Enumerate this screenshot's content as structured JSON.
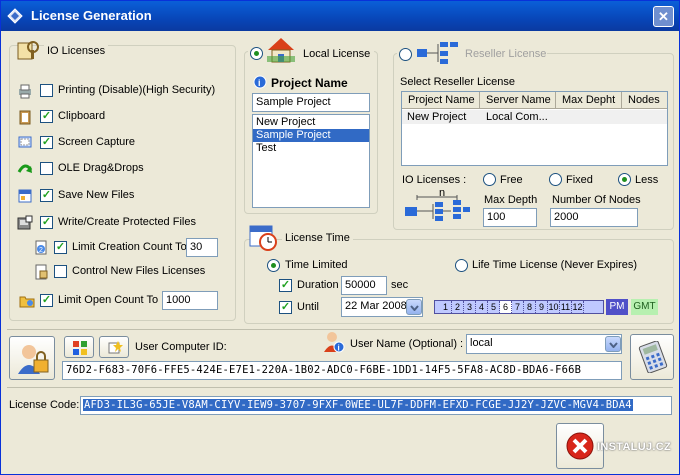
{
  "window": {
    "title": "License Generation",
    "close_symbol": "✕"
  },
  "io_licenses": {
    "title": "IO Licenses",
    "items": [
      {
        "label": "Printing (Disable)(High Security)",
        "checked": false,
        "icon": "printer-icon"
      },
      {
        "label": "Clipboard",
        "checked": true,
        "icon": "clipboard-icon"
      },
      {
        "label": "Screen Capture",
        "checked": true,
        "icon": "screen-capture-icon"
      },
      {
        "label": "OLE Drag&Drops",
        "checked": false,
        "icon": "drag-drop-icon"
      },
      {
        "label": "Save New Files",
        "checked": true,
        "icon": "save-file-icon"
      },
      {
        "label": "Write/Create Protected Files",
        "checked": true,
        "icon": "protected-files-icon"
      },
      {
        "label": "Limit Creation Count To",
        "checked": true,
        "icon": "creation-count-icon",
        "value": "30"
      },
      {
        "label": "Control New Files Licenses",
        "checked": false,
        "icon": "file-license-icon"
      },
      {
        "label": "Limit Open Count To",
        "checked": true,
        "icon": "open-count-icon",
        "value": "1000"
      }
    ]
  },
  "local_license": {
    "title": "Local License",
    "selected": true,
    "project_name_label": "Project Name",
    "project_name_value": "Sample Project",
    "projects": [
      "New Project",
      "Sample Project",
      "Test"
    ],
    "selected_project": "Sample Project"
  },
  "reseller_license": {
    "title": "Reseller License",
    "selected": false,
    "select_label": "Select Reseller License",
    "columns": [
      "Project Name",
      "Server Name",
      "Max Depht",
      "Nodes"
    ],
    "rows": [
      [
        "New Project",
        "Local Com...",
        "",
        ""
      ]
    ],
    "io_label": "IO Licenses :",
    "io_options": [
      "Free",
      "Fixed",
      "Less"
    ],
    "io_selected": "Less",
    "tree_label": "n",
    "max_depth_label": "Max Depth",
    "max_depth_value": "100",
    "nodes_label": "Number Of Nodes",
    "nodes_value": "2000"
  },
  "license_time": {
    "title": "License Time",
    "time_limited_label": "Time Limited",
    "time_limited": true,
    "lifetime_label": "Life Time License (Never Expires)",
    "duration_label": "Duration",
    "duration_checked": true,
    "duration_value": "50000",
    "duration_unit": "sec",
    "until_label": "Until",
    "until_checked": true,
    "until_value": "22 Mar 2008",
    "hours": [
      "1",
      "2",
      "3",
      "4",
      "5",
      "6",
      "7",
      "8",
      "9",
      "10",
      "11",
      "12"
    ],
    "ampm": "PM",
    "timezone": "GMT"
  },
  "computer": {
    "user_computer_id_label": "User Computer ID:",
    "user_name_label": "User Name (Optional) :",
    "user_name_value": "local",
    "computer_id": "76D2-F683-70F6-FFE5-424E-E7E1-220A-1B02-ADC0-F6BE-1DD1-14F5-5FA8-AC8D-BDA6-F66B"
  },
  "license_code": {
    "label": "License Code:",
    "value": "AFD3-IL3G-65JE-V8AM-CIYV-IEW9-3707-9FXF-0WEE-UL7F-DDFM-EFXD-FCGE-JJ2Y-JZVC-MGV4-BDA4"
  },
  "watermark": "INSTALUJ.CZ",
  "colors": {
    "titlebar": "#0a5fd8",
    "selection": "#316ac5",
    "window_bg": "#ece9d8"
  }
}
